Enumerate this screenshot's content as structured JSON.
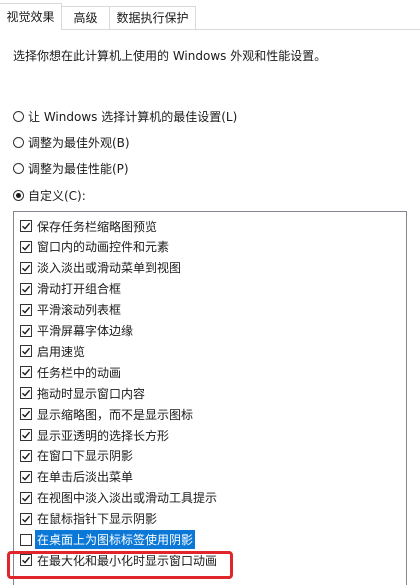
{
  "tabs": [
    {
      "label": "视觉效果",
      "active": true
    },
    {
      "label": "高级",
      "active": false
    },
    {
      "label": "数据执行保护",
      "active": false
    }
  ],
  "description": "选择你想在此计算机上使用的 Windows 外观和性能设置。",
  "radio_options": [
    {
      "label": "让 Windows 选择计算机的最佳设置(L)",
      "checked": false
    },
    {
      "label": "调整为最佳外观(B)",
      "checked": false
    },
    {
      "label": "调整为最佳性能(P)",
      "checked": false
    },
    {
      "label": "自定义(C):",
      "checked": true
    }
  ],
  "effects": [
    {
      "label": "保存任务栏缩略图预览",
      "checked": true
    },
    {
      "label": "窗口内的动画控件和元素",
      "checked": true
    },
    {
      "label": "淡入淡出或滑动菜单到视图",
      "checked": true
    },
    {
      "label": "滑动打开组合框",
      "checked": true
    },
    {
      "label": "平滑滚动列表框",
      "checked": true
    },
    {
      "label": "平滑屏幕字体边缘",
      "checked": true
    },
    {
      "label": "启用速览",
      "checked": true
    },
    {
      "label": "任务栏中的动画",
      "checked": true
    },
    {
      "label": "拖动时显示窗口内容",
      "checked": true
    },
    {
      "label": "显示缩略图，而不是显示图标",
      "checked": true
    },
    {
      "label": "显示亚透明的选择长方形",
      "checked": true
    },
    {
      "label": "在窗口下显示阴影",
      "checked": true
    },
    {
      "label": "在单击后淡出菜单",
      "checked": true
    },
    {
      "label": "在视图中淡入淡出或滑动工具提示",
      "checked": true
    },
    {
      "label": "在鼠标指针下显示阴影",
      "checked": true
    },
    {
      "label": "在桌面上为图标标签使用阴影",
      "checked": false,
      "selected": true
    },
    {
      "label": "在最大化和最小化时显示窗口动画",
      "checked": true
    }
  ],
  "colors": {
    "selection": "#0b78d7",
    "annotation": "#e0262b"
  }
}
